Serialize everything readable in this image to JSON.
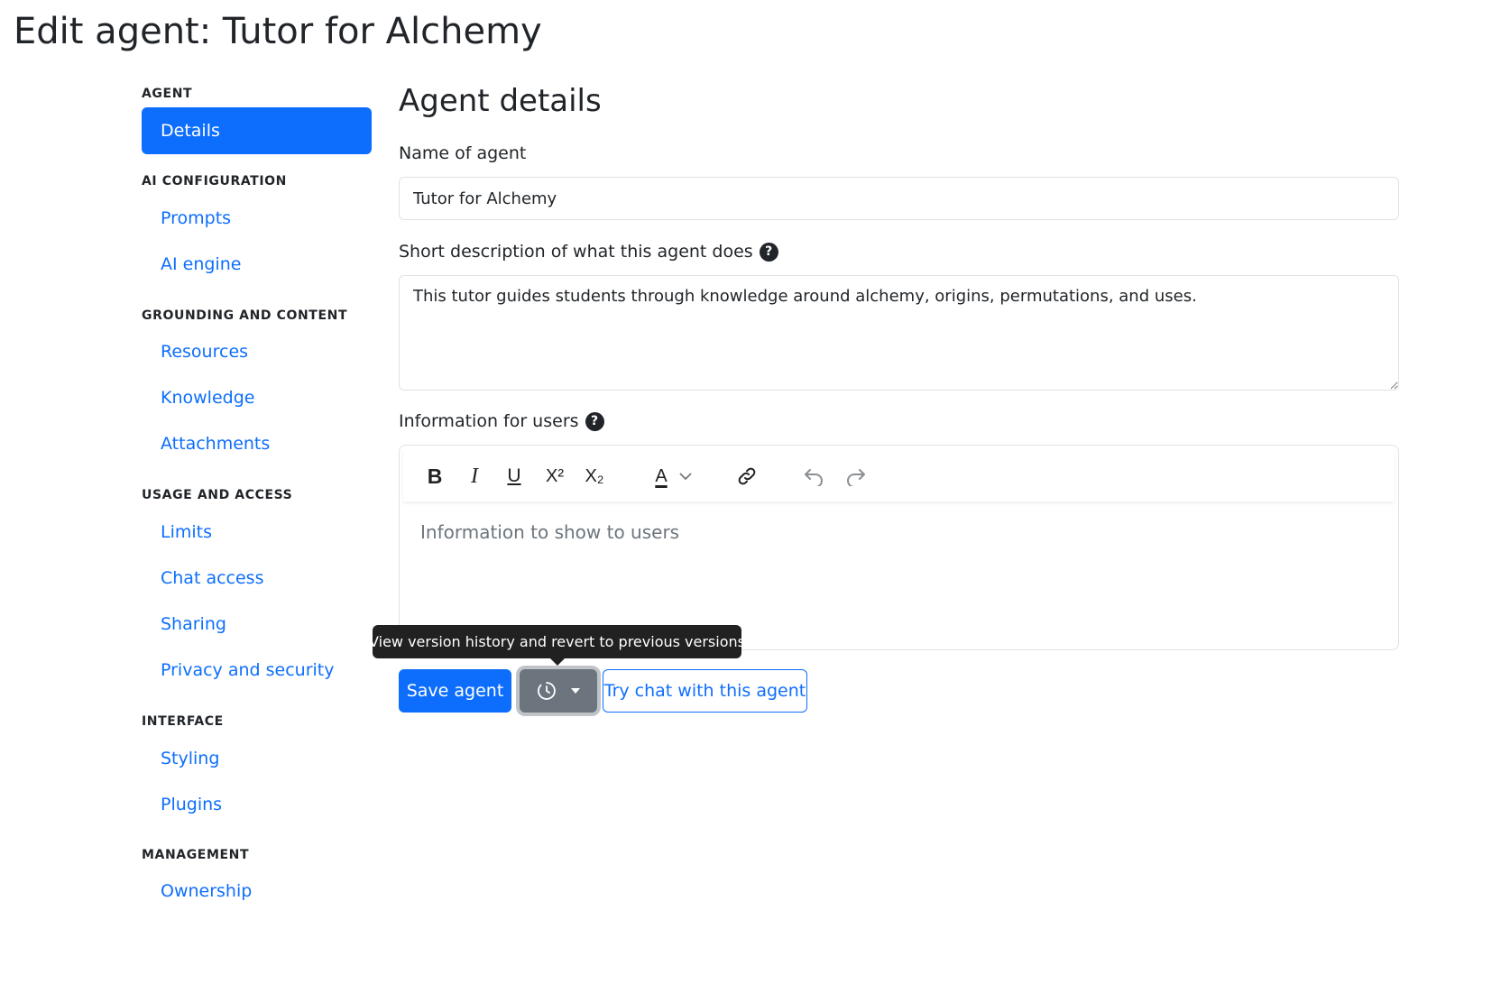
{
  "page": {
    "title": "Edit agent: Tutor for Alchemy"
  },
  "sidebar": {
    "sections": [
      {
        "heading": "AGENT",
        "items": [
          {
            "label": "Details",
            "active": true
          }
        ]
      },
      {
        "heading": "AI CONFIGURATION",
        "items": [
          {
            "label": "Prompts"
          },
          {
            "label": "AI engine"
          }
        ]
      },
      {
        "heading": "GROUNDING AND CONTENT",
        "items": [
          {
            "label": "Resources"
          },
          {
            "label": "Knowledge"
          },
          {
            "label": "Attachments"
          }
        ]
      },
      {
        "heading": "USAGE AND ACCESS",
        "items": [
          {
            "label": "Limits"
          },
          {
            "label": "Chat access"
          },
          {
            "label": "Sharing"
          },
          {
            "label": "Privacy and security"
          }
        ]
      },
      {
        "heading": "INTERFACE",
        "items": [
          {
            "label": "Styling"
          },
          {
            "label": "Plugins"
          }
        ]
      },
      {
        "heading": "MANAGEMENT",
        "items": [
          {
            "label": "Ownership"
          }
        ]
      }
    ]
  },
  "main": {
    "section_title": "Agent details",
    "name_field": {
      "label": "Name of agent",
      "value": "Tutor for Alchemy"
    },
    "description_field": {
      "label": "Short description of what this agent does",
      "value": "This tutor guides students through knowledge around alchemy, origins, permutations, and uses."
    },
    "info_field": {
      "label": "Information for users",
      "placeholder": "Information to show to users"
    },
    "toolbar": {
      "bold": "B",
      "italic": "I",
      "underline": "U",
      "superscript": "X²",
      "subscript": "X₂",
      "font_color": "A"
    }
  },
  "actions": {
    "save_label": "Save agent",
    "try_label": "Try chat with this agent",
    "tooltip": "View version history and revert to previous versions"
  },
  "colors": {
    "primary": "#0d6efd",
    "secondary": "#6c757d",
    "tooltip": "#212121"
  }
}
